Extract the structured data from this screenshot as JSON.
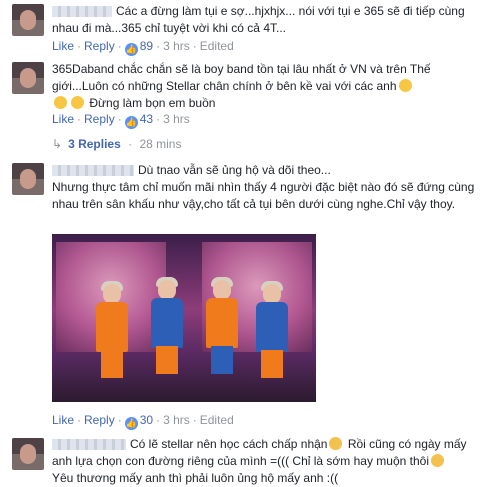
{
  "comments": [
    {
      "text": "Các a đừng làm tụi e sợ...hjxhjx... nói với tụi e 365 sẽ đi tiếp cùng nhau đi mà...365 chỉ tuyệt vời khi có cả 4T...",
      "like": "Like",
      "reply": "Reply",
      "likes": "89",
      "time": "3 hrs",
      "edited": "Edited"
    },
    {
      "text1": "365Daband chắc chắn sẽ là boy band tồn tại lâu nhất ở VN và trên Thế giới...Luôn có những Stellar chân chính ở bên kề vai với các anh",
      "text2": "Đừng làm bọn em buồn",
      "like": "Like",
      "reply": "Reply",
      "likes": "43",
      "time": "3 hrs",
      "replies_label": "3 Replies",
      "replies_time": "28 mins"
    },
    {
      "text1": "Dù tnao vẫn sẽ ủng hộ và dõi theo...",
      "text2": "Nhưng thực tâm chỉ muốn mãi nhìn thấy 4 người đặc biệt nào đó sẽ đứng cùng nhau trên sân khấu như vậy,cho tất cả tụi bên dưới cùng nghe.Chỉ vậy thoy.",
      "like": "Like",
      "reply": "Reply",
      "likes": "30",
      "time": "3 hrs",
      "edited": "Edited"
    },
    {
      "text1": "Có lẽ stellar nên học cách chấp nhận",
      "text2": "Rồi cũng có ngày mấy anh lựa chọn con đường riêng của mình =((( Chỉ là sớm hay muộn thôi",
      "text3": "Yêu thương mấy anh thì phải luôn ủng hộ mấy anh :(("
    }
  ],
  "icons": {
    "like_badge": "thumbs-up-icon",
    "reply_arrow": "reply-arrow-icon"
  },
  "colors": {
    "link": "#4267b2",
    "meta": "#90949c",
    "text": "#1d2129",
    "like_badge": "#5890ff"
  }
}
